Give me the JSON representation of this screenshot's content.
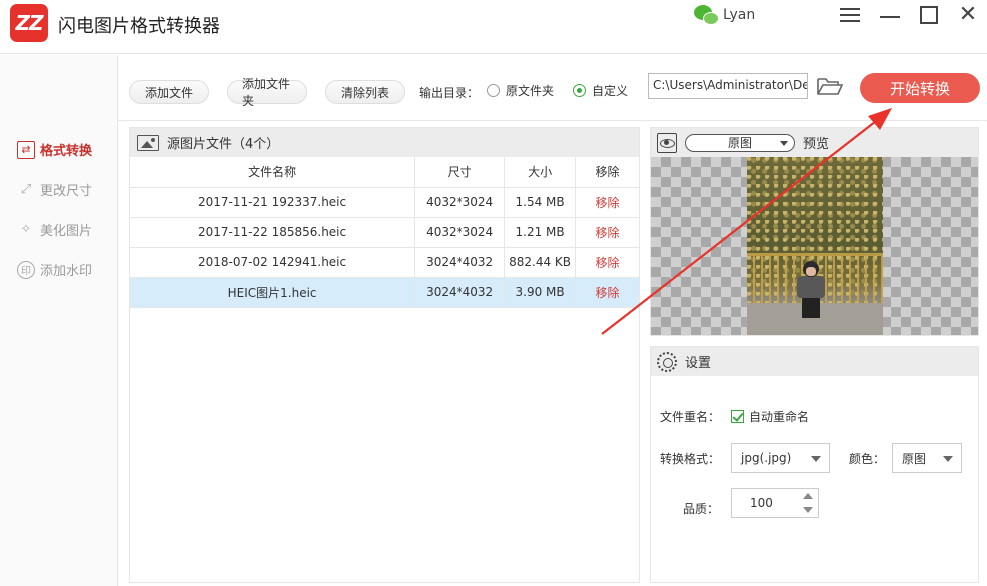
{
  "app": {
    "logo_text": "ZZ",
    "title": "闪电图片格式转换器",
    "user_name": "Lyan"
  },
  "sidebar": {
    "items": [
      {
        "label": "格式转换",
        "icon": "swap-arrows-icon",
        "active": true
      },
      {
        "label": "更改尺寸",
        "icon": "resize-icon",
        "active": false
      },
      {
        "label": "美化图片",
        "icon": "sparkle-image-icon",
        "active": false
      },
      {
        "label": "添加水印",
        "icon": "watermark-stamp-icon",
        "active": false
      }
    ]
  },
  "toolbar": {
    "add_file": "添加文件",
    "add_folder": "添加文件夹",
    "clear_list": "清除列表",
    "output_label": "输出目录：",
    "radio_original": "原文件夹",
    "radio_custom": "自定义",
    "output_path": "C:\\Users\\Administrator\\De",
    "start": "开始转换"
  },
  "file_panel": {
    "title": "源图片文件（4个）",
    "columns": [
      "文件名称",
      "尺寸",
      "大小",
      "移除"
    ],
    "rows": [
      {
        "name": "2017-11-21 192337.heic",
        "size": "4032*3024",
        "filesize": "1.54 MB",
        "remove": "移除"
      },
      {
        "name": "2017-11-22 185856.heic",
        "size": "4032*3024",
        "filesize": "1.21 MB",
        "remove": "移除"
      },
      {
        "name": "2018-07-02 142941.heic",
        "size": "3024*4032",
        "filesize": "882.44 KB",
        "remove": "移除"
      },
      {
        "name": "HEIC图片1.heic",
        "size": "3024*4032",
        "filesize": "3.90 MB",
        "remove": "移除"
      }
    ],
    "selected_row": 3
  },
  "preview": {
    "mode": "原图",
    "label": "预览"
  },
  "settings": {
    "title": "设置",
    "rename_label": "文件重名：",
    "rename_check": "自动重命名",
    "format_label": "转换格式：",
    "format_value": "jpg(.jpg)",
    "color_label": "颜色：",
    "color_value": "原图",
    "quality_label": "品质：",
    "quality_value": "100"
  },
  "colors": {
    "accent_red": "#c8302c",
    "start_button": "#ea5a4e",
    "check_green": "#3ca53c",
    "selected_row": "#d6ecfb",
    "annotation_arrow": "#e8322b"
  }
}
